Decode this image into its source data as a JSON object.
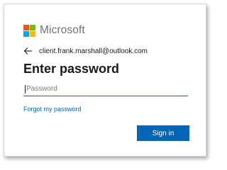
{
  "brand": {
    "name": "Microsoft",
    "colors": {
      "red": "#f25022",
      "green": "#7fba00",
      "blue": "#00a4ef",
      "yellow": "#ffb900",
      "text": "#737373"
    }
  },
  "identity": {
    "back_icon": "back-arrow-icon",
    "email": "client.frank.marshall@outlook.com"
  },
  "page": {
    "title": "Enter password"
  },
  "password": {
    "placeholder": "Password",
    "value": ""
  },
  "links": {
    "forgot_password": "Forgot my password"
  },
  "actions": {
    "sign_in_label": "Sign in",
    "accent": "#0067b8"
  }
}
